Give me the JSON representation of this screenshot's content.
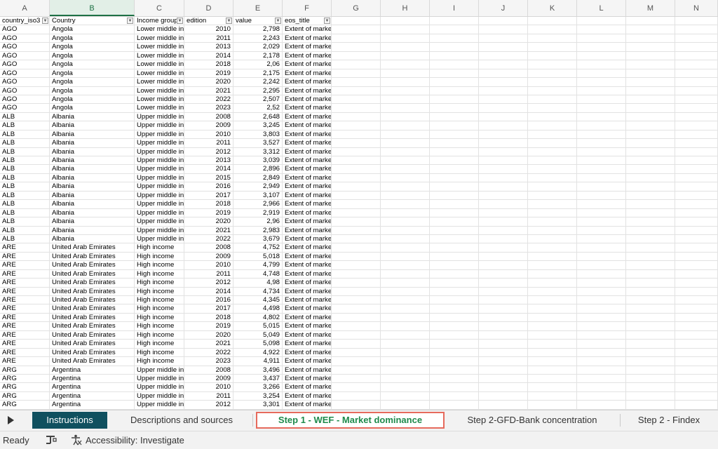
{
  "columns": [
    "A",
    "B",
    "C",
    "D",
    "E",
    "F",
    "G",
    "H",
    "I",
    "J",
    "K",
    "L",
    "M",
    "N"
  ],
  "selected_column": "B",
  "header_row": [
    "country_iso3",
    "Country",
    "Income group",
    "edition",
    "value",
    "eos_title"
  ],
  "rows": [
    [
      "AGO",
      "Angola",
      "Lower middle income",
      "2010",
      "2,798",
      "Extent of market dominance"
    ],
    [
      "AGO",
      "Angola",
      "Lower middle income",
      "2011",
      "2,243",
      "Extent of market dominance"
    ],
    [
      "AGO",
      "Angola",
      "Lower middle income",
      "2013",
      "2,029",
      "Extent of market dominance"
    ],
    [
      "AGO",
      "Angola",
      "Lower middle income",
      "2014",
      "2,178",
      "Extent of market dominance"
    ],
    [
      "AGO",
      "Angola",
      "Lower middle income",
      "2018",
      "2,06",
      "Extent of market dominance"
    ],
    [
      "AGO",
      "Angola",
      "Lower middle income",
      "2019",
      "2,175",
      "Extent of market dominance"
    ],
    [
      "AGO",
      "Angola",
      "Lower middle income",
      "2020",
      "2,242",
      "Extent of market dominance"
    ],
    [
      "AGO",
      "Angola",
      "Lower middle income",
      "2021",
      "2,295",
      "Extent of market dominance"
    ],
    [
      "AGO",
      "Angola",
      "Lower middle income",
      "2022",
      "2,507",
      "Extent of market dominance"
    ],
    [
      "AGO",
      "Angola",
      "Lower middle income",
      "2023",
      "2,52",
      "Extent of market dominance"
    ],
    [
      "ALB",
      "Albania",
      "Upper middle income",
      "2008",
      "2,648",
      "Extent of market dominance"
    ],
    [
      "ALB",
      "Albania",
      "Upper middle income",
      "2009",
      "3,245",
      "Extent of market dominance"
    ],
    [
      "ALB",
      "Albania",
      "Upper middle income",
      "2010",
      "3,803",
      "Extent of market dominance"
    ],
    [
      "ALB",
      "Albania",
      "Upper middle income",
      "2011",
      "3,527",
      "Extent of market dominance"
    ],
    [
      "ALB",
      "Albania",
      "Upper middle income",
      "2012",
      "3,312",
      "Extent of market dominance"
    ],
    [
      "ALB",
      "Albania",
      "Upper middle income",
      "2013",
      "3,039",
      "Extent of market dominance"
    ],
    [
      "ALB",
      "Albania",
      "Upper middle income",
      "2014",
      "2,896",
      "Extent of market dominance"
    ],
    [
      "ALB",
      "Albania",
      "Upper middle income",
      "2015",
      "2,849",
      "Extent of market dominance"
    ],
    [
      "ALB",
      "Albania",
      "Upper middle income",
      "2016",
      "2,949",
      "Extent of market dominance"
    ],
    [
      "ALB",
      "Albania",
      "Upper middle income",
      "2017",
      "3,107",
      "Extent of market dominance"
    ],
    [
      "ALB",
      "Albania",
      "Upper middle income",
      "2018",
      "2,966",
      "Extent of market dominance"
    ],
    [
      "ALB",
      "Albania",
      "Upper middle income",
      "2019",
      "2,919",
      "Extent of market dominance"
    ],
    [
      "ALB",
      "Albania",
      "Upper middle income",
      "2020",
      "2,96",
      "Extent of market dominance"
    ],
    [
      "ALB",
      "Albania",
      "Upper middle income",
      "2021",
      "2,983",
      "Extent of market dominance"
    ],
    [
      "ALB",
      "Albania",
      "Upper middle income",
      "2022",
      "3,679",
      "Extent of market dominance"
    ],
    [
      "ARE",
      "United Arab Emirates",
      "High income",
      "2008",
      "4,752",
      "Extent of market dominance"
    ],
    [
      "ARE",
      "United Arab Emirates",
      "High income",
      "2009",
      "5,018",
      "Extent of market dominance"
    ],
    [
      "ARE",
      "United Arab Emirates",
      "High income",
      "2010",
      "4,799",
      "Extent of market dominance"
    ],
    [
      "ARE",
      "United Arab Emirates",
      "High income",
      "2011",
      "4,748",
      "Extent of market dominance"
    ],
    [
      "ARE",
      "United Arab Emirates",
      "High income",
      "2012",
      "4,98",
      "Extent of market dominance"
    ],
    [
      "ARE",
      "United Arab Emirates",
      "High income",
      "2014",
      "4,734",
      "Extent of market dominance"
    ],
    [
      "ARE",
      "United Arab Emirates",
      "High income",
      "2016",
      "4,345",
      "Extent of market dominance"
    ],
    [
      "ARE",
      "United Arab Emirates",
      "High income",
      "2017",
      "4,498",
      "Extent of market dominance"
    ],
    [
      "ARE",
      "United Arab Emirates",
      "High income",
      "2018",
      "4,802",
      "Extent of market dominance"
    ],
    [
      "ARE",
      "United Arab Emirates",
      "High income",
      "2019",
      "5,015",
      "Extent of market dominance"
    ],
    [
      "ARE",
      "United Arab Emirates",
      "High income",
      "2020",
      "5,049",
      "Extent of market dominance"
    ],
    [
      "ARE",
      "United Arab Emirates",
      "High income",
      "2021",
      "5,098",
      "Extent of market dominance"
    ],
    [
      "ARE",
      "United Arab Emirates",
      "High income",
      "2022",
      "4,922",
      "Extent of market dominance"
    ],
    [
      "ARE",
      "United Arab Emirates",
      "High income",
      "2023",
      "4,911",
      "Extent of market dominance"
    ],
    [
      "ARG",
      "Argentina",
      "Upper middle income",
      "2008",
      "3,496",
      "Extent of market dominance"
    ],
    [
      "ARG",
      "Argentina",
      "Upper middle income",
      "2009",
      "3,437",
      "Extent of market dominance"
    ],
    [
      "ARG",
      "Argentina",
      "Upper middle income",
      "2010",
      "3,266",
      "Extent of market dominance"
    ],
    [
      "ARG",
      "Argentina",
      "Upper middle income",
      "2011",
      "3,254",
      "Extent of market dominance"
    ],
    [
      "ARG",
      "Argentina",
      "Upper middle income",
      "2012",
      "3,301",
      "Extent of market dominance"
    ]
  ],
  "tabs": {
    "nav_icon": "play-right-icon",
    "instructions": "Instructions",
    "descriptions": "Descriptions and sources",
    "step1": "Step 1 - WEF - Market dominance",
    "step2_bank": "Step 2-GFD-Bank concentration",
    "step2_findex": "Step 2 - Findex"
  },
  "status": {
    "ready": "Ready",
    "accessibility": "Accessibility: Investigate"
  },
  "colors": {
    "accent": "#1e7145",
    "active_tab": "#10505f",
    "highlight_border": "#e66a5c"
  }
}
